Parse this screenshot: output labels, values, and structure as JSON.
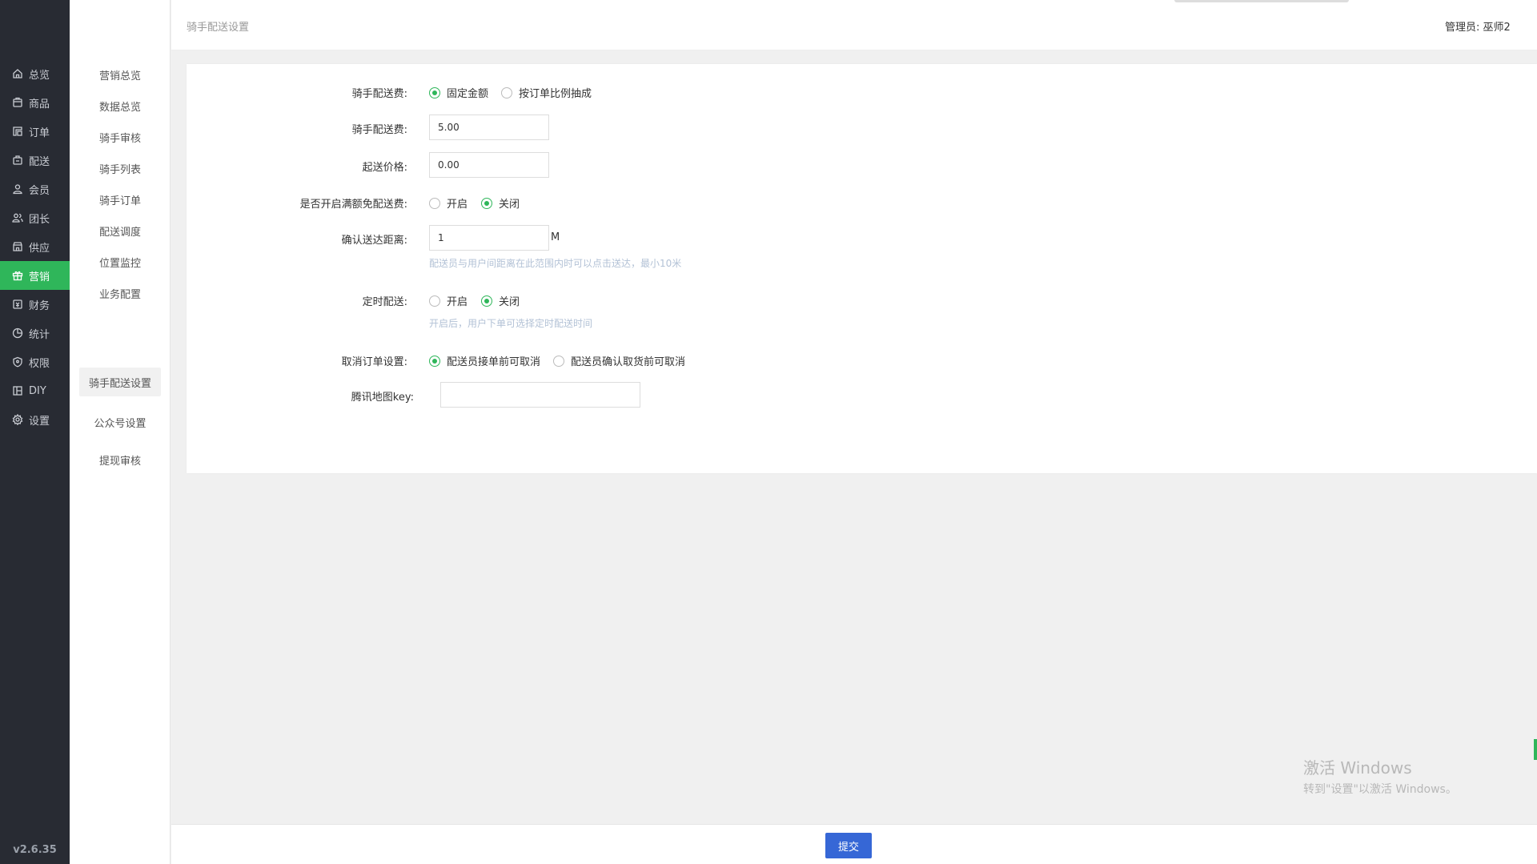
{
  "nav_primary": {
    "items": [
      {
        "label": "总览",
        "icon": "home-icon"
      },
      {
        "label": "商品",
        "icon": "box-icon"
      },
      {
        "label": "订单",
        "icon": "order-icon"
      },
      {
        "label": "配送",
        "icon": "delivery-icon"
      },
      {
        "label": "会员",
        "icon": "user-icon"
      },
      {
        "label": "团长",
        "icon": "team-icon"
      },
      {
        "label": "供应",
        "icon": "store-icon"
      },
      {
        "label": "营销",
        "icon": "gift-icon"
      },
      {
        "label": "财务",
        "icon": "finance-icon"
      },
      {
        "label": "统计",
        "icon": "pie-chart-icon"
      },
      {
        "label": "权限",
        "icon": "shield-icon"
      },
      {
        "label": "DIY",
        "icon": "layout-icon"
      },
      {
        "label": "设置",
        "icon": "gear-icon"
      }
    ],
    "active_index": 7,
    "version": "v2.6.35",
    "accent_color": "#2fb65a"
  },
  "nav_secondary": {
    "items": [
      "营销总览",
      "数据总览",
      "骑手审核",
      "骑手列表",
      "骑手订单",
      "配送调度",
      "位置监控",
      "业务配置",
      "骑手配送设置",
      "公众号设置",
      "提现审核"
    ],
    "active_index": 8
  },
  "header": {
    "title": "骑手配送设置",
    "admin_label": "管理员:",
    "admin_name": "巫师2"
  },
  "form": {
    "fee_mode": {
      "label": "骑手配送费:",
      "options": [
        "固定金额",
        "按订单比例抽成"
      ],
      "selected": 0
    },
    "fee_amount": {
      "label": "骑手配送费:",
      "value": "5.00"
    },
    "min_price": {
      "label": "起送价格:",
      "value": "0.00"
    },
    "free_shipping": {
      "label": "是否开启满额免配送费:",
      "options": [
        "开启",
        "关闭"
      ],
      "selected": 1
    },
    "confirm_distance": {
      "label": "确认送达距离:",
      "value": "1",
      "unit": "M",
      "hint": "配送员与用户间距离在此范围内时可以点击送达，最小10米"
    },
    "scheduled": {
      "label": "定时配送:",
      "options": [
        "开启",
        "关闭"
      ],
      "selected": 1,
      "hint": "开启后，用户下单可选择定时配送时间"
    },
    "cancel_setting": {
      "label": "取消订单设置:",
      "options": [
        "配送员接单前可取消",
        "配送员确认取货前可取消"
      ],
      "selected": 0
    },
    "map_key": {
      "label": "腾讯地图key:",
      "value": ""
    }
  },
  "footer": {
    "submit_label": "提交",
    "button_color": "#3667d6"
  },
  "watermark": {
    "line1": "激活 Windows",
    "line2": "转到\"设置\"以激活 Windows。"
  }
}
